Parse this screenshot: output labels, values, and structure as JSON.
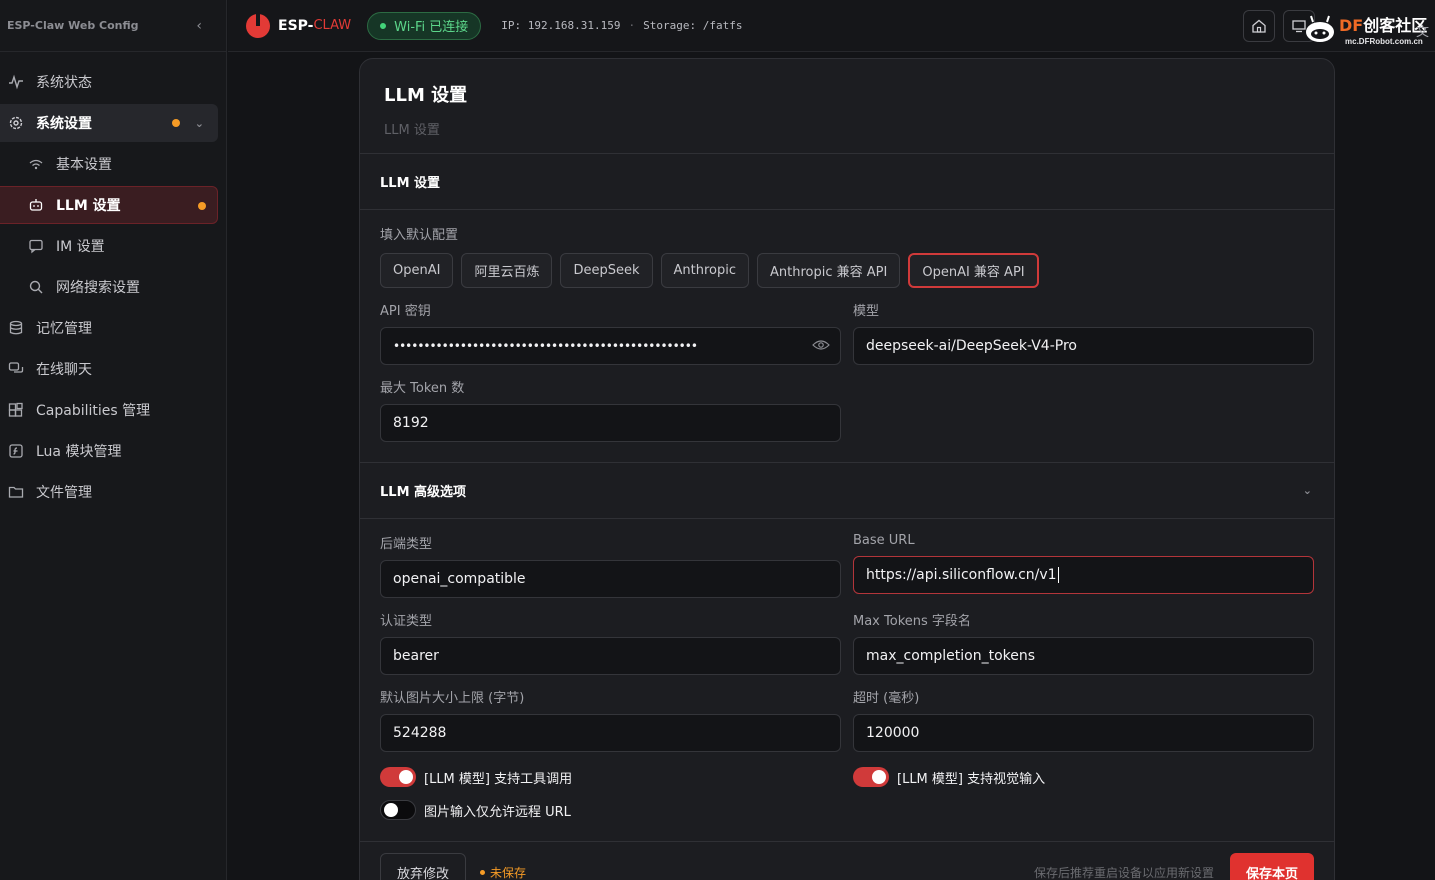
{
  "sidebar": {
    "title": "ESP-Claw Web Config",
    "items": [
      {
        "label": "系统状态"
      },
      {
        "label": "系统设置"
      },
      {
        "label": "基本设置"
      },
      {
        "label": "LLM 设置"
      },
      {
        "label": "IM 设置"
      },
      {
        "label": "网络搜索设置"
      },
      {
        "label": "记忆管理"
      },
      {
        "label": "在线聊天"
      },
      {
        "label": "Capabilities 管理"
      },
      {
        "label": "Lua 模块管理"
      },
      {
        "label": "文件管理"
      }
    ]
  },
  "topbar": {
    "brand": "ESP-",
    "brand2": "CLAW",
    "wifi": "Wi-Fi 已连接",
    "ip": "IP: 192.168.31.159",
    "storage": "Storage: /fatfs",
    "watermark_df": "DF",
    "watermark_cn": "创客社区",
    "watermark_url": "mc.DFRobot.com.cn",
    "lang": "文"
  },
  "card": {
    "title": "LLM 设置",
    "subtitle": "LLM 设置",
    "section1": "LLM 设置",
    "preset_label": "填入默认配置",
    "presets": [
      "OpenAI",
      "阿里云百炼",
      "DeepSeek",
      "Anthropic",
      "Anthropic 兼容 API",
      "OpenAI 兼容 API"
    ],
    "api_key_label": "API 密钥",
    "api_key_value": "••••••••••••••••••••••••••••••••••••••••••••••••••",
    "model_label": "模型",
    "model_value": "deepseek-ai/DeepSeek-V4-Pro",
    "max_token_label": "最大 Token 数",
    "max_token_value": "8192",
    "section2": "LLM 高级选项",
    "backend_label": "后端类型",
    "backend_value": "openai_compatible",
    "base_url_label": "Base URL",
    "base_url_value": "https://api.siliconflow.cn/v1",
    "auth_label": "认证类型",
    "auth_value": "bearer",
    "max_tokens_field_label": "Max Tokens 字段名",
    "max_tokens_field_value": "max_completion_tokens",
    "img_limit_label": "默认图片大小上限 (字节)",
    "img_limit_value": "524288",
    "timeout_label": "超时 (毫秒)",
    "timeout_value": "120000",
    "toggle_tools": "[LLM 模型] 支持工具调用",
    "toggle_vision": "[LLM 模型] 支持视觉输入",
    "toggle_remote": "图片输入仅允许远程 URL"
  },
  "footer": {
    "discard": "放弃修改",
    "unsaved": "未保存",
    "hint": "保存后推荐重启设备以应用新设置",
    "save": "保存本页"
  }
}
